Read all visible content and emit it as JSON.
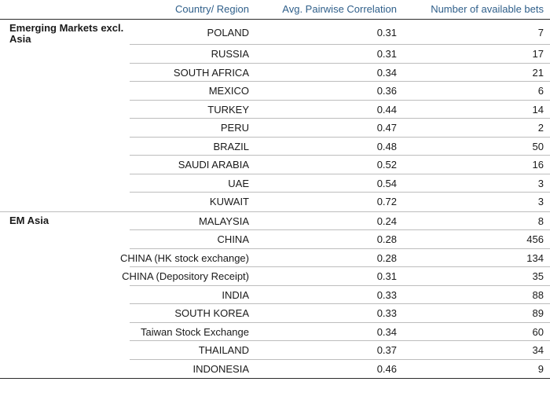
{
  "header": {
    "country": "Country/ Region",
    "correlation": "Avg. Pairwise Correlation",
    "bets": "Number of available bets"
  },
  "groups": [
    {
      "region": "Emerging Markets excl. Asia",
      "rows": [
        {
          "country": "POLAND",
          "corr": "0.31",
          "bets": "7"
        },
        {
          "country": "RUSSIA",
          "corr": "0.31",
          "bets": "17"
        },
        {
          "country": "SOUTH AFRICA",
          "corr": "0.34",
          "bets": "21"
        },
        {
          "country": "MEXICO",
          "corr": "0.36",
          "bets": "6"
        },
        {
          "country": "TURKEY",
          "corr": "0.44",
          "bets": "14"
        },
        {
          "country": "PERU",
          "corr": "0.47",
          "bets": "2"
        },
        {
          "country": "BRAZIL",
          "corr": "0.48",
          "bets": "50"
        },
        {
          "country": "SAUDI ARABIA",
          "corr": "0.52",
          "bets": "16"
        },
        {
          "country": "UAE",
          "corr": "0.54",
          "bets": "3"
        },
        {
          "country": "KUWAIT",
          "corr": "0.72",
          "bets": "3"
        }
      ]
    },
    {
      "region": "EM Asia",
      "rows": [
        {
          "country": "MALAYSIA",
          "corr": "0.24",
          "bets": "8"
        },
        {
          "country": "CHINA",
          "corr": "0.28",
          "bets": "456"
        },
        {
          "country": "CHINA (HK stock exchange)",
          "corr": "0.28",
          "bets": "134"
        },
        {
          "country": "CHINA (Depository Receipt)",
          "corr": "0.31",
          "bets": "35"
        },
        {
          "country": "INDIA",
          "corr": "0.33",
          "bets": "88"
        },
        {
          "country": "SOUTH KOREA",
          "corr": "0.33",
          "bets": "89"
        },
        {
          "country": "Taiwan Stock Exchange",
          "corr": "0.34",
          "bets": "60"
        },
        {
          "country": "THAILAND",
          "corr": "0.37",
          "bets": "34"
        },
        {
          "country": "INDONESIA",
          "corr": "0.46",
          "bets": "9"
        }
      ]
    }
  ]
}
